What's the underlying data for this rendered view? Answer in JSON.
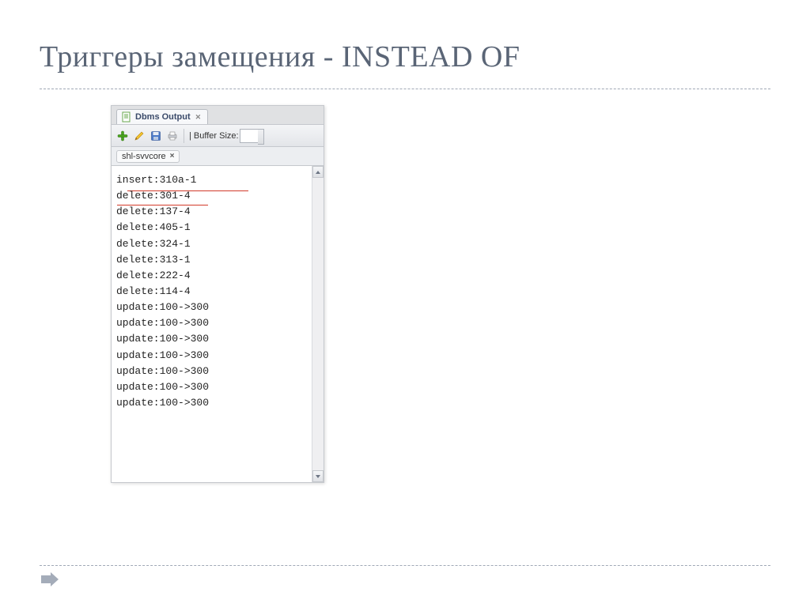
{
  "title": "Триггеры замещения - INSTEAD OF",
  "panel": {
    "tab_label": "Dbms Output",
    "buffer_label": "| Buffer Size:",
    "sub_tab": "shl-svvcore",
    "lines": [
      "insert:310a-1",
      "",
      "delete:301-4",
      "delete:137-4",
      "delete:405-1",
      "delete:324-1",
      "delete:313-1",
      "delete:222-4",
      "delete:114-4",
      "",
      "update:100->300",
      "update:100->300",
      "update:100->300",
      "update:100->300",
      "update:100->300",
      "update:100->300",
      "update:100->300"
    ]
  }
}
